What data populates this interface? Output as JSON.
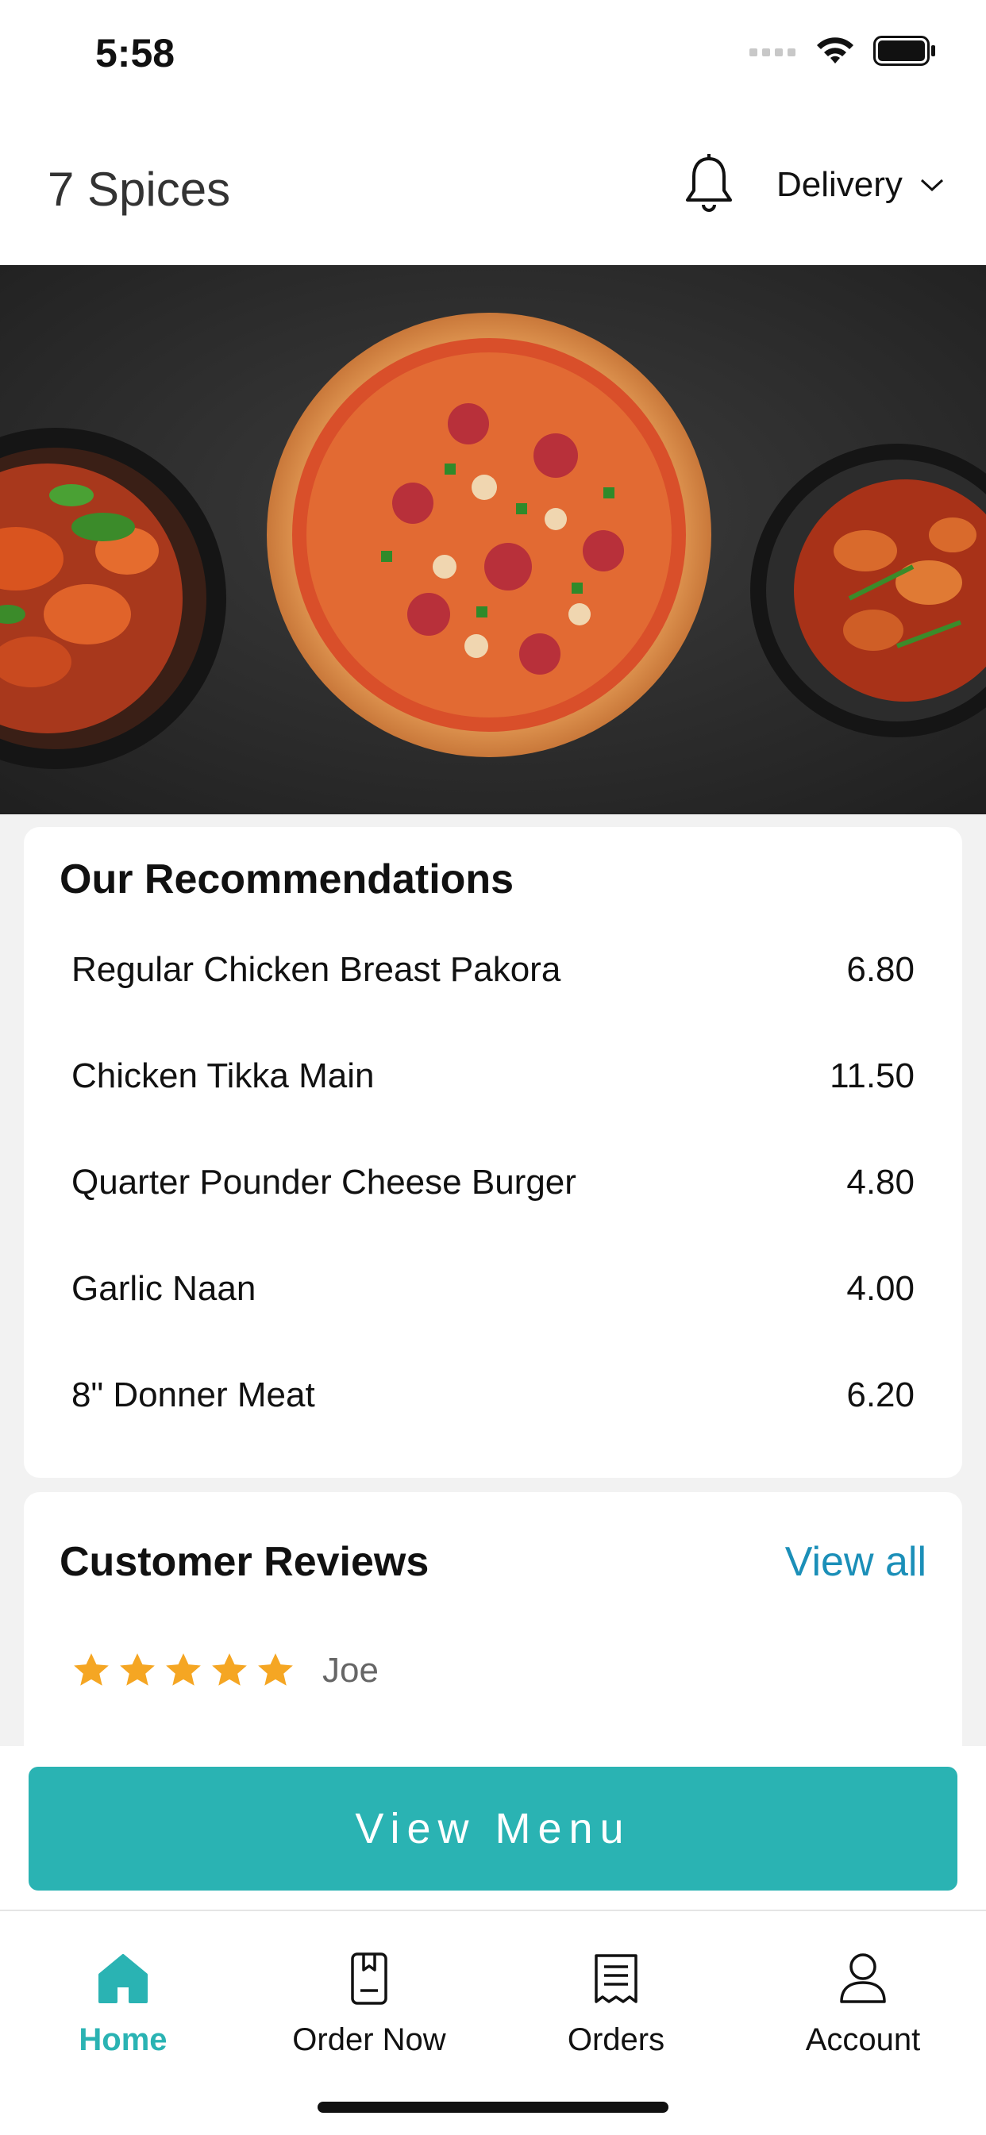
{
  "status_bar": {
    "time": "5:58"
  },
  "header": {
    "title": "7 Spices",
    "delivery_label": "Delivery"
  },
  "recommendations": {
    "title": "Our Recommendations",
    "items": [
      {
        "name": "Regular Chicken Breast Pakora",
        "price": "6.80"
      },
      {
        "name": "Chicken Tikka Main",
        "price": "11.50"
      },
      {
        "name": "Quarter Pounder Cheese Burger",
        "price": "4.80"
      },
      {
        "name": "Garlic Naan",
        "price": "4.00"
      },
      {
        "name": "8\" Donner Meat",
        "price": "6.20"
      }
    ]
  },
  "reviews": {
    "title": "Customer Reviews",
    "view_all_label": "View all",
    "items": [
      {
        "reviewer": "Joe",
        "rating": 5
      }
    ]
  },
  "cta": {
    "label": "View Menu"
  },
  "tabs": [
    {
      "label": "Home",
      "icon": "home-icon",
      "active": true
    },
    {
      "label": "Order Now",
      "icon": "order-now-icon",
      "active": false
    },
    {
      "label": "Orders",
      "icon": "receipt-icon",
      "active": false
    },
    {
      "label": "Account",
      "icon": "account-icon",
      "active": false
    }
  ],
  "colors": {
    "accent": "#2ab3b3",
    "link": "#1b8fb8",
    "star": "#f5a623"
  }
}
